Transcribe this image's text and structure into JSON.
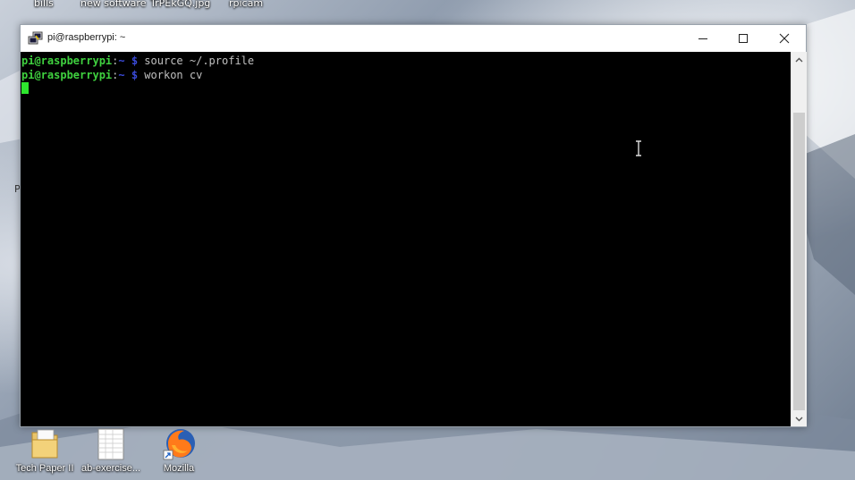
{
  "desktop": {
    "top_labels": [
      "bills",
      "new software",
      "TrPEkGQ.jpg",
      "rpicam"
    ],
    "stray_char": "P",
    "icons": [
      {
        "label": "Tech Paper II",
        "icon": "folder-document-icon"
      },
      {
        "label": "ab-exercise...",
        "icon": "spreadsheet-file-icon"
      },
      {
        "label": "Mozilla",
        "icon": "firefox-icon"
      }
    ]
  },
  "window": {
    "title": "pi@raspberrypi: ~",
    "app_icon": "putty-icon",
    "controls": {
      "minimize": "minimize-icon",
      "maximize": "maximize-icon",
      "close": "close-icon"
    }
  },
  "terminal": {
    "lines": [
      {
        "user": "pi@raspberrypi",
        "sep": ":",
        "path": "~ $",
        "command": " source ~/.profile"
      },
      {
        "user": "pi@raspberrypi",
        "sep": ":",
        "path": "~ $",
        "command": " workon cv"
      }
    ]
  },
  "colors": {
    "prompt_user": "#3fd13f",
    "prompt_path": "#3a4ad8",
    "cursor": "#2ee62e",
    "terminal_bg": "#000000"
  }
}
